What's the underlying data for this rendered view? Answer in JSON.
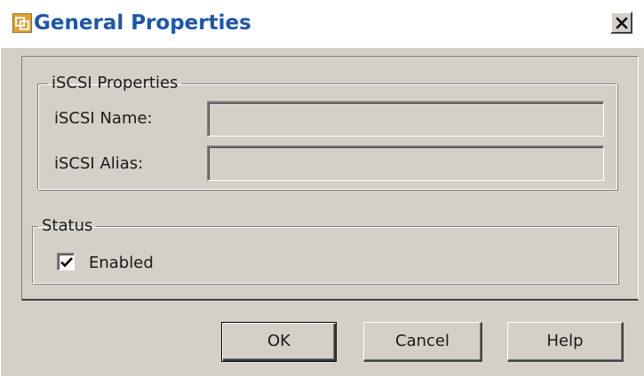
{
  "window": {
    "title": "General Properties",
    "close_symbol": "×",
    "app_icon": "vsphere-logo-icon",
    "close_icon": "close-icon"
  },
  "iscsi_properties": {
    "legend": "iSCSI Properties",
    "name_label": "iSCSI Name:",
    "name_value": "",
    "alias_label": "iSCSI Alias:",
    "alias_value": ""
  },
  "status": {
    "legend": "Status",
    "enabled_label": "Enabled",
    "enabled_checked": true
  },
  "buttons": {
    "ok": "OK",
    "cancel": "Cancel",
    "help": "Help"
  },
  "colors": {
    "title_text": "#1e56a8",
    "dialog_background": "#d4d0c8",
    "app_icon": "#e3a233"
  }
}
